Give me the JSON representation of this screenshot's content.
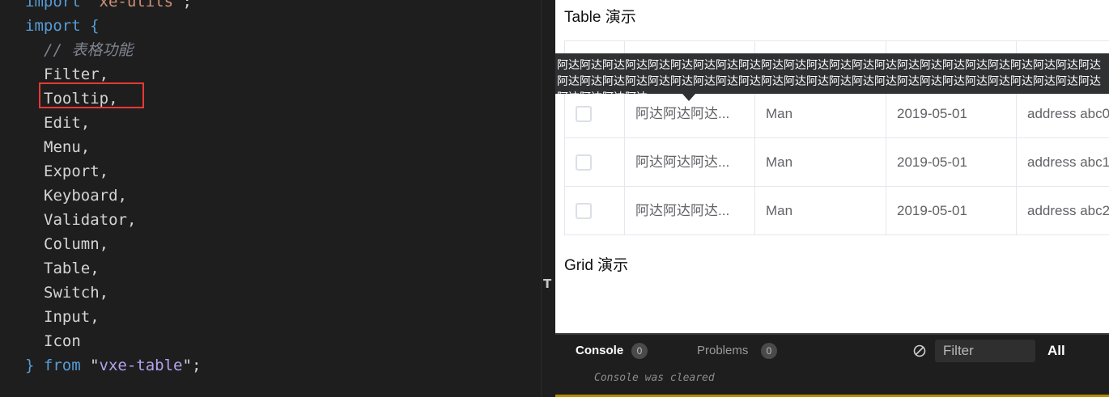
{
  "editor": {
    "lines": [
      {
        "indent": "",
        "parts": [
          {
            "t": "import ",
            "c": "kw"
          },
          {
            "t": "\"xe-utils\"",
            "c": "str"
          },
          {
            "t": ";",
            "c": "punc"
          }
        ]
      },
      {
        "indent": "",
        "parts": [
          {
            "t": "import ",
            "c": "kw"
          },
          {
            "t": "{",
            "c": "kw"
          }
        ]
      },
      {
        "indent": "  ",
        "parts": [
          {
            "t": "// 表格功能",
            "c": "com"
          }
        ]
      },
      {
        "indent": "  ",
        "parts": [
          {
            "t": "Filter,",
            "c": "punc"
          }
        ]
      },
      {
        "indent": "  ",
        "parts": [
          {
            "t": "Tooltip,",
            "c": "punc"
          }
        ]
      },
      {
        "indent": "  ",
        "parts": [
          {
            "t": "Edit,",
            "c": "punc"
          }
        ]
      },
      {
        "indent": "  ",
        "parts": [
          {
            "t": "Menu,",
            "c": "punc"
          }
        ]
      },
      {
        "indent": "  ",
        "parts": [
          {
            "t": "Export,",
            "c": "punc"
          }
        ]
      },
      {
        "indent": "  ",
        "parts": [
          {
            "t": "Keyboard,",
            "c": "punc"
          }
        ]
      },
      {
        "indent": "  ",
        "parts": [
          {
            "t": "Validator,",
            "c": "punc"
          }
        ]
      },
      {
        "indent": "  ",
        "parts": [
          {
            "t": "Column,",
            "c": "punc"
          }
        ]
      },
      {
        "indent": "  ",
        "parts": [
          {
            "t": "Table,",
            "c": "punc"
          }
        ]
      },
      {
        "indent": "  ",
        "parts": [
          {
            "t": "Switch,",
            "c": "punc"
          }
        ]
      },
      {
        "indent": "  ",
        "parts": [
          {
            "t": "Input,",
            "c": "punc"
          }
        ]
      },
      {
        "indent": "  ",
        "parts": [
          {
            "t": "Icon",
            "c": "punc"
          }
        ]
      },
      {
        "indent": "",
        "parts": [
          {
            "t": "} ",
            "c": "kw"
          },
          {
            "t": "from ",
            "c": "kw"
          },
          {
            "t": "\"",
            "c": "punc"
          },
          {
            "t": "vxe-table",
            "c": "kw2"
          },
          {
            "t": "\"",
            "c": "punc"
          },
          {
            "t": ";",
            "c": "punc"
          }
        ]
      }
    ],
    "highlighted_line": "Tooltip,"
  },
  "preview": {
    "table_title": "Table 演示",
    "grid_title": "Grid 演示",
    "tooltip_text": "阿达阿达阿达阿达阿达阿达阿达阿达阿达阿达阿达阿达阿达阿达阿达阿达阿达阿达阿达阿达阿达阿达阿达阿达阿达阿达阿达阿达阿达阿达阿达阿达阿达阿达阿达阿达阿达阿达阿达阿达阿达阿达阿达阿达阿达阿达阿达阿达阿达阿达阿达阿达",
    "rows": [
      {
        "name": "阿达阿达阿达...",
        "sex": "Man",
        "date": "2019-05-01",
        "address": "address abc0"
      },
      {
        "name": "阿达阿达阿达...",
        "sex": "Man",
        "date": "2019-05-01",
        "address": "address abc1"
      },
      {
        "name": "阿达阿达阿达...",
        "sex": "Man",
        "date": "2019-05-01",
        "address": "address abc2"
      }
    ]
  },
  "console": {
    "tab_console": "Console",
    "console_count": "0",
    "tab_problems": "Problems",
    "problems_count": "0",
    "filter_placeholder": "Filter",
    "level": "All",
    "message": "Console was cleared"
  },
  "colors": {
    "highlight_border": "#e53935",
    "tooltip_bg": "#303133",
    "console_accent": "#b58b00"
  }
}
